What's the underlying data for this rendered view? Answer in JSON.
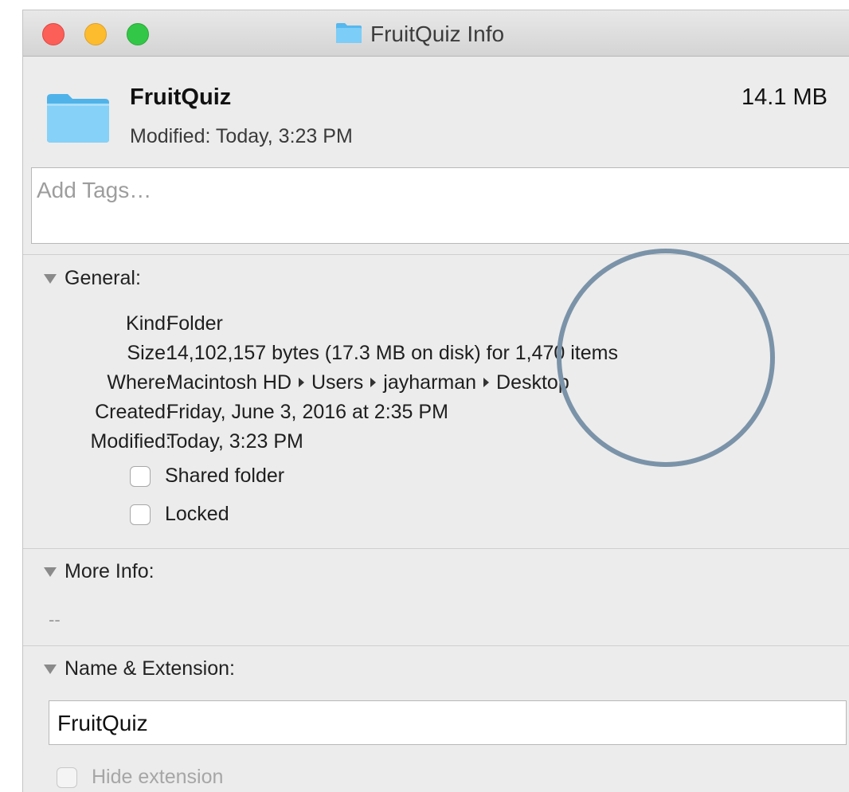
{
  "window": {
    "title": "FruitQuiz Info",
    "controls": [
      "close",
      "minimize",
      "zoom"
    ]
  },
  "header": {
    "name": "FruitQuiz",
    "modified": "Modified: Today, 3:23 PM",
    "size": "14.1 MB",
    "icon": "folder-icon"
  },
  "tags": {
    "placeholder": "Add Tags…"
  },
  "general": {
    "heading": "General:",
    "kind_label": "Kind:",
    "kind_value": "Folder",
    "size_label": "Size:",
    "size_value": "14,102,157 bytes (17.3 MB on disk) for 1,470 items",
    "where_label": "Where:",
    "where_path": [
      "Macintosh HD",
      "Users",
      "jayharman",
      "Desktop"
    ],
    "created_label": "Created:",
    "created_value": "Friday, June 3, 2016 at 2:35 PM",
    "modified_label": "Modified:",
    "modified_value": "Today, 3:23 PM",
    "shared_folder": "Shared folder",
    "locked": "Locked"
  },
  "more_info": {
    "heading": "More Info:",
    "value": "--"
  },
  "name_extension": {
    "heading": "Name & Extension:",
    "name_value": "FruitQuiz",
    "hide_extension": "Hide extension"
  },
  "colors": {
    "folder": "#5bbdf2",
    "annotation_circle": "#7b93a8",
    "window_bg": "#ececec"
  }
}
